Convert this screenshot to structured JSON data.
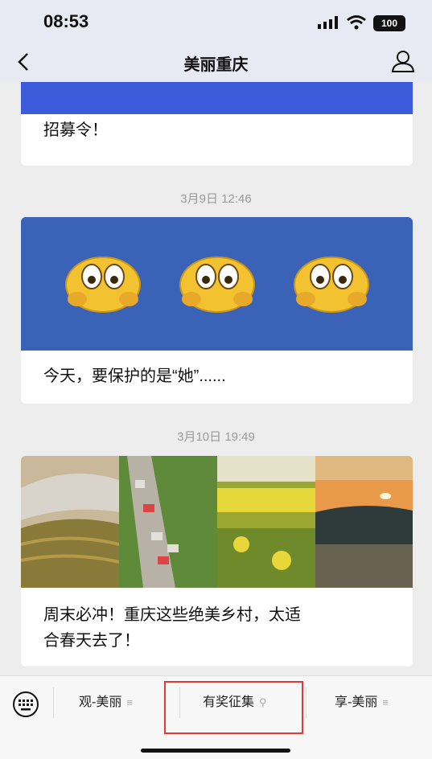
{
  "status": {
    "time": "08:53",
    "battery": "100"
  },
  "nav": {
    "title": "美丽重庆"
  },
  "feed": {
    "card1_text": "招募令！",
    "ts1": "3月9日 12:46",
    "card2_text": "今天，要保护的是“她”......",
    "ts2": "3月10日 19:49",
    "card3_text_line1": "周末必冲！重庆这些绝美乡村，太适",
    "card3_text_line2": "合春天去了！"
  },
  "tabbar": {
    "tab1": "观-美丽",
    "tab2": "有奖征集",
    "tab3": "享-美丽"
  },
  "colors": {
    "banner_blue": "#3b5bdb",
    "card2_bg": "#3a63b8",
    "highlight": "#e53935"
  }
}
